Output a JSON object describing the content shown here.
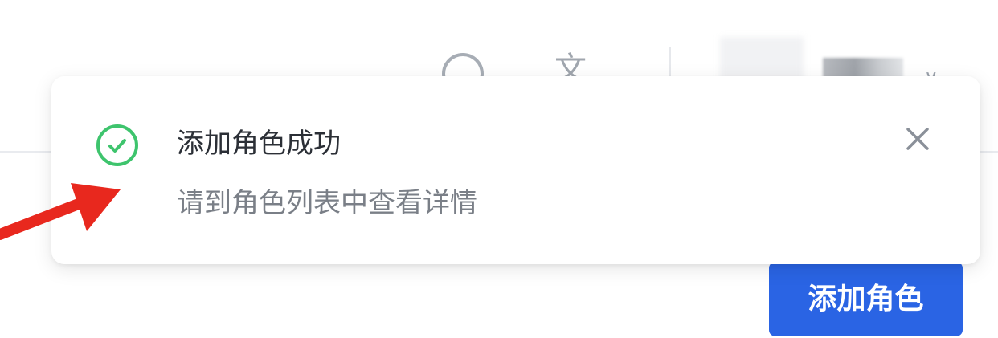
{
  "header": {
    "help_icon": "help-circle-icon",
    "language_icon_glyph": "文",
    "user_chevron_icon": "chevron-down-icon"
  },
  "notification": {
    "icon": "check-circle-icon",
    "title": "添加角色成功",
    "description": "请到角色列表中查看详情",
    "close_icon": "close-icon"
  },
  "actions": {
    "add_role_label": "添加角色"
  },
  "colors": {
    "primary": "#2a64e4",
    "success": "#3ec46d",
    "annotation": "#e8281e"
  }
}
